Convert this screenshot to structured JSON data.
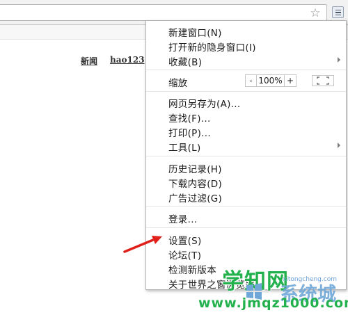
{
  "toolbar": {
    "star_icon": "star-icon",
    "menu_icon": "hamburger-menu-icon"
  },
  "page": {
    "links": [
      "新闻",
      "hao123"
    ]
  },
  "menu": {
    "group1": [
      {
        "label": "新建窗口(N)"
      },
      {
        "label": "打开新的隐身窗口(I)"
      },
      {
        "label": "收藏(B)",
        "submenu": true
      }
    ],
    "zoom": {
      "label": "缩放",
      "minus": "-",
      "value": "100%",
      "plus": "+",
      "fullscreen_icon": "fullscreen-icon"
    },
    "group2": [
      {
        "label": "网页另存为(A)..."
      },
      {
        "label": "查找(F)..."
      },
      {
        "label": "打印(P)..."
      },
      {
        "label": "工具(L)",
        "submenu": true
      }
    ],
    "group3": [
      {
        "label": "历史记录(H)"
      },
      {
        "label": "下载内容(D)"
      },
      {
        "label": "广告过滤(G)"
      }
    ],
    "group4": [
      {
        "label": "登录..."
      }
    ],
    "group5": [
      {
        "label": "设置(S)"
      },
      {
        "label": "论坛(T)"
      },
      {
        "label": "检测新版本"
      },
      {
        "label": "关于世界之窗浏览器"
      }
    ]
  },
  "watermark": {
    "main": "学知网",
    "side": "系统城",
    "url": "www.jmqz1000.com",
    "url2": "xitongcheng.com"
  },
  "colors": {
    "arrow": "#e0201b",
    "watermark_green": "#22b14c",
    "watermark_blue": "#6fa7d8"
  }
}
